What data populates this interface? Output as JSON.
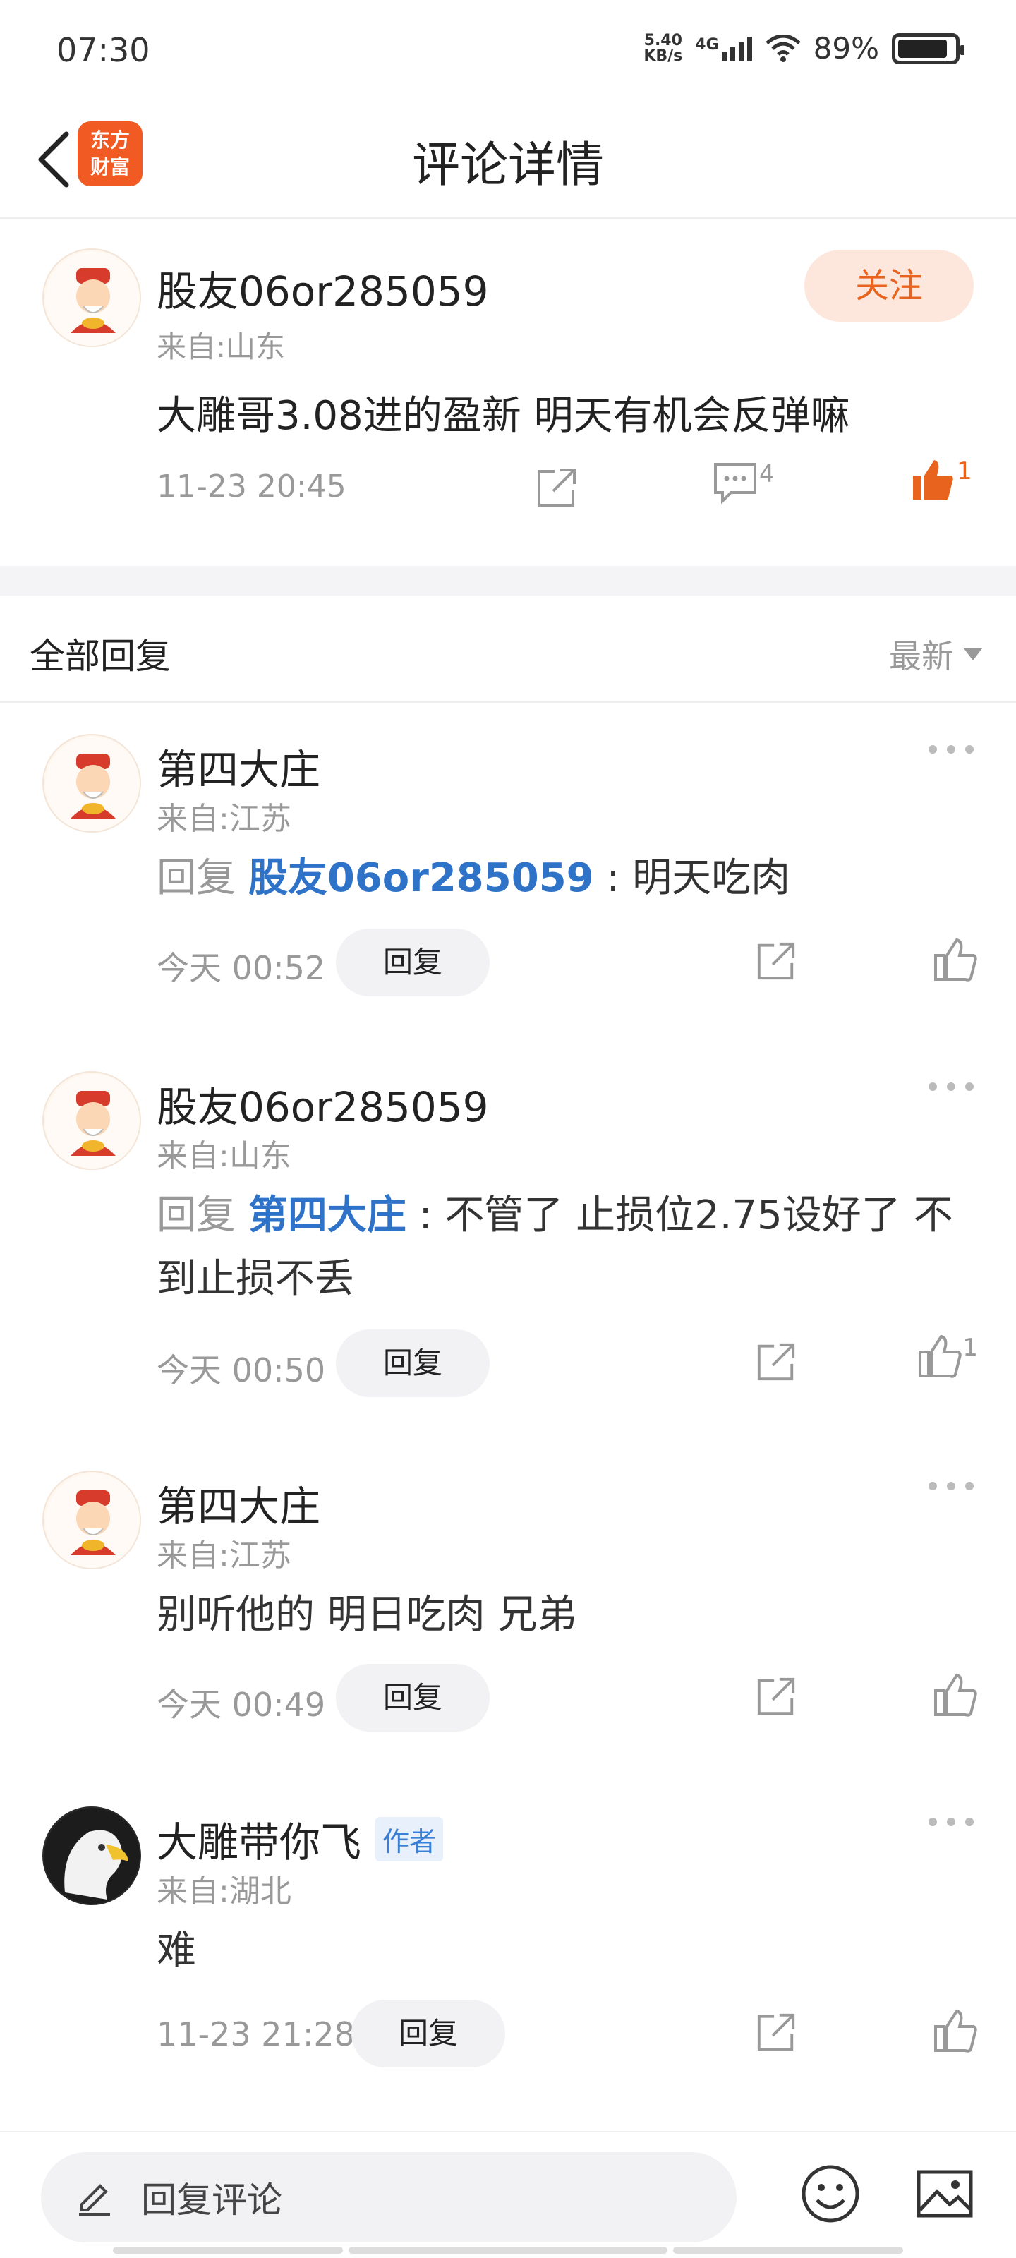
{
  "status_bar": {
    "time": "07:30",
    "net_speed_value": "5.40",
    "net_speed_unit": "KB/s",
    "network": "4G",
    "battery_text": "89%",
    "battery_level": 0.89
  },
  "header": {
    "title": "评论详情",
    "logo_line1": "东方",
    "logo_line2": "财富"
  },
  "post": {
    "username": "股友06or285059",
    "location": "来自:山东",
    "follow_label": "关注",
    "text": "大雕哥3.08进的盈新 明天有机会反弹嘛",
    "time": "11-23 20:45",
    "comment_count": "4",
    "like_count": "1"
  },
  "replies_header": {
    "title": "全部回复",
    "sort_label": "最新"
  },
  "replies": [
    {
      "username": "第四大庄",
      "location": "来自:江苏",
      "reply_prefix": "回复",
      "mention": "股友06or285059",
      "separator": ":",
      "text": "明天吃肉",
      "time": "今天 00:52",
      "reply_label": "回复",
      "like_count": ""
    },
    {
      "username": "股友06or285059",
      "location": "来自:山东",
      "reply_prefix": "回复",
      "mention": "第四大庄",
      "separator": ":",
      "text": "不管了 止损位2.75设好了 不到止损不丢",
      "time": "今天 00:50",
      "reply_label": "回复",
      "like_count": "1"
    },
    {
      "username": "第四大庄",
      "location": "来自:江苏",
      "text": "别听他的 明日吃肉 兄弟",
      "time": "今天 00:49",
      "reply_label": "回复",
      "like_count": ""
    },
    {
      "username": "大雕带你飞",
      "badge": "作者",
      "location": "来自:湖北",
      "text": "难",
      "time": "11-23 21:28",
      "reply_label": "回复",
      "like_count": ""
    }
  ],
  "bottom_bar": {
    "placeholder": "回复评论"
  },
  "colors": {
    "accent": "#e8631e",
    "mention": "#2f73c9",
    "muted": "#999999"
  }
}
